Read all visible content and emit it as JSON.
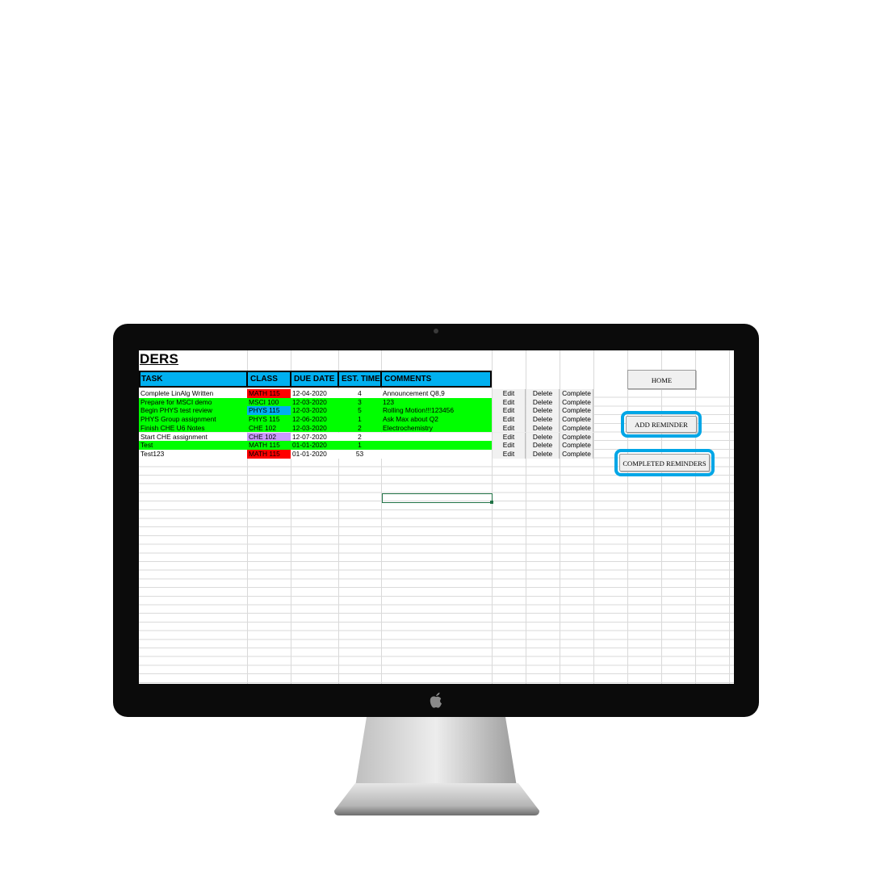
{
  "sheet": {
    "title": "DERS",
    "columns": [
      "TASK",
      "CLASS",
      "DUE DATE",
      "EST. TIME",
      "COMMENTS"
    ],
    "rows": [
      {
        "task": "Complete LinAlg Written",
        "class": "MATH 115",
        "due": "12-04-2020",
        "time": "4",
        "comment": "Announcement Q8,9",
        "row_color": "#ffffff",
        "class_color": "#ff0000"
      },
      {
        "task": "Prepare for MSCI demo",
        "class": "MSCI 100",
        "due": "12-03-2020",
        "time": "3",
        "comment": "123",
        "row_color": "#00ff00",
        "class_color": "#00ff00"
      },
      {
        "task": "Begin PHYS test review",
        "class": "PHYS 115",
        "due": "12-03-2020",
        "time": "5",
        "comment": "Rolling Motion!!!123456",
        "row_color": "#00ff00",
        "class_color": "#00b0f0"
      },
      {
        "task": "PHYS Group assignment",
        "class": "PHYS 115",
        "due": "12-06-2020",
        "time": "1",
        "comment": "Ask Max about Q2",
        "row_color": "#00ff00",
        "class_color": "#00ff00"
      },
      {
        "task": "Finish CHE U6 Notes",
        "class": "CHE 102",
        "due": "12-03-2020",
        "time": "2",
        "comment": "Electrochemistry",
        "row_color": "#00ff00",
        "class_color": "#00ff00"
      },
      {
        "task": "Start CHE assignment",
        "class": "CHE 102",
        "due": "12-07-2020",
        "time": "2",
        "comment": "",
        "row_color": "#ffffff",
        "class_color": "#cc99ff"
      },
      {
        "task": "Test",
        "class": "MATH 115",
        "due": "01-01-2020",
        "time": "1",
        "comment": "",
        "row_color": "#00ff00",
        "class_color": "#00ff00"
      },
      {
        "task": "Test123",
        "class": "MATH 115",
        "due": "01-01-2020",
        "time": "53",
        "comment": "",
        "row_color": "#ffffff",
        "class_color": "#ff0000"
      }
    ],
    "row_actions": {
      "edit": "Edit",
      "delete": "Delete",
      "complete": "Complete"
    }
  },
  "buttons": {
    "home": "HOME",
    "add_reminder": "ADD REMINDER",
    "completed_reminders": "COMPLETED REMINDERS"
  },
  "colors": {
    "header": "#00b0f0",
    "highlight_outline": "#00a6e6",
    "selection": "#217346",
    "monitor_bezel": "#0b0b0b"
  },
  "icons": [
    "apple-logo-icon",
    "camera-icon"
  ]
}
